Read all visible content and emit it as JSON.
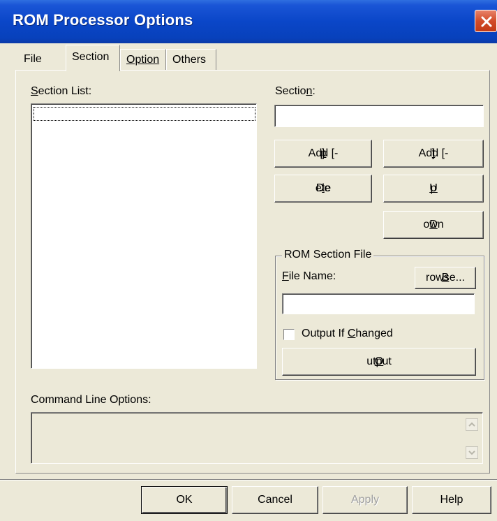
{
  "window": {
    "title": "ROM Processor Options"
  },
  "tabs": [
    {
      "label": "File",
      "active": false
    },
    {
      "label": "Section",
      "active": true
    },
    {
      "label": "Option",
      "active": false
    },
    {
      "label": "Others",
      "active": false
    }
  ],
  "section_list": {
    "label_prefix": "",
    "label_mnemonic": "S",
    "label_rest": "ection List:",
    "items": [
      ""
    ]
  },
  "section": {
    "label_prefix": "Sectio",
    "label_mnemonic": "n",
    "label_rest": ":",
    "value": ""
  },
  "buttons": {
    "add_p": {
      "prefix": "Add [-",
      "mnemonic": "p",
      "suffix": "]"
    },
    "add_t": {
      "prefix": "Add [-",
      "mnemonic": "t",
      "suffix": "]"
    },
    "delete": {
      "prefix": "De",
      "mnemonic": "l",
      "suffix": "ete"
    },
    "up": {
      "prefix": "",
      "mnemonic": "U",
      "suffix": "p"
    },
    "down": {
      "prefix": "",
      "mnemonic": "D",
      "suffix": "own"
    }
  },
  "rom_section_file": {
    "group_title": "ROM Section File",
    "file_name_mnemonic": "F",
    "file_name_rest": "ile Name:",
    "browse": {
      "mnemonic": "B",
      "rest": "rowse..."
    },
    "file_name_value": "",
    "output_if_changed": {
      "prefix": "Output If ",
      "mnemonic": "C",
      "suffix": "hanged",
      "checked": false
    },
    "output": {
      "mnemonic": "O",
      "rest": "utput"
    }
  },
  "command_line": {
    "label": "Command Line Options:",
    "value": ""
  },
  "footer": {
    "ok": "OK",
    "cancel": "Cancel",
    "apply": "Apply",
    "help": "Help"
  },
  "colors": {
    "titlebar": "#0a46c8",
    "close": "#d24c2a",
    "face": "#ece9d8"
  }
}
